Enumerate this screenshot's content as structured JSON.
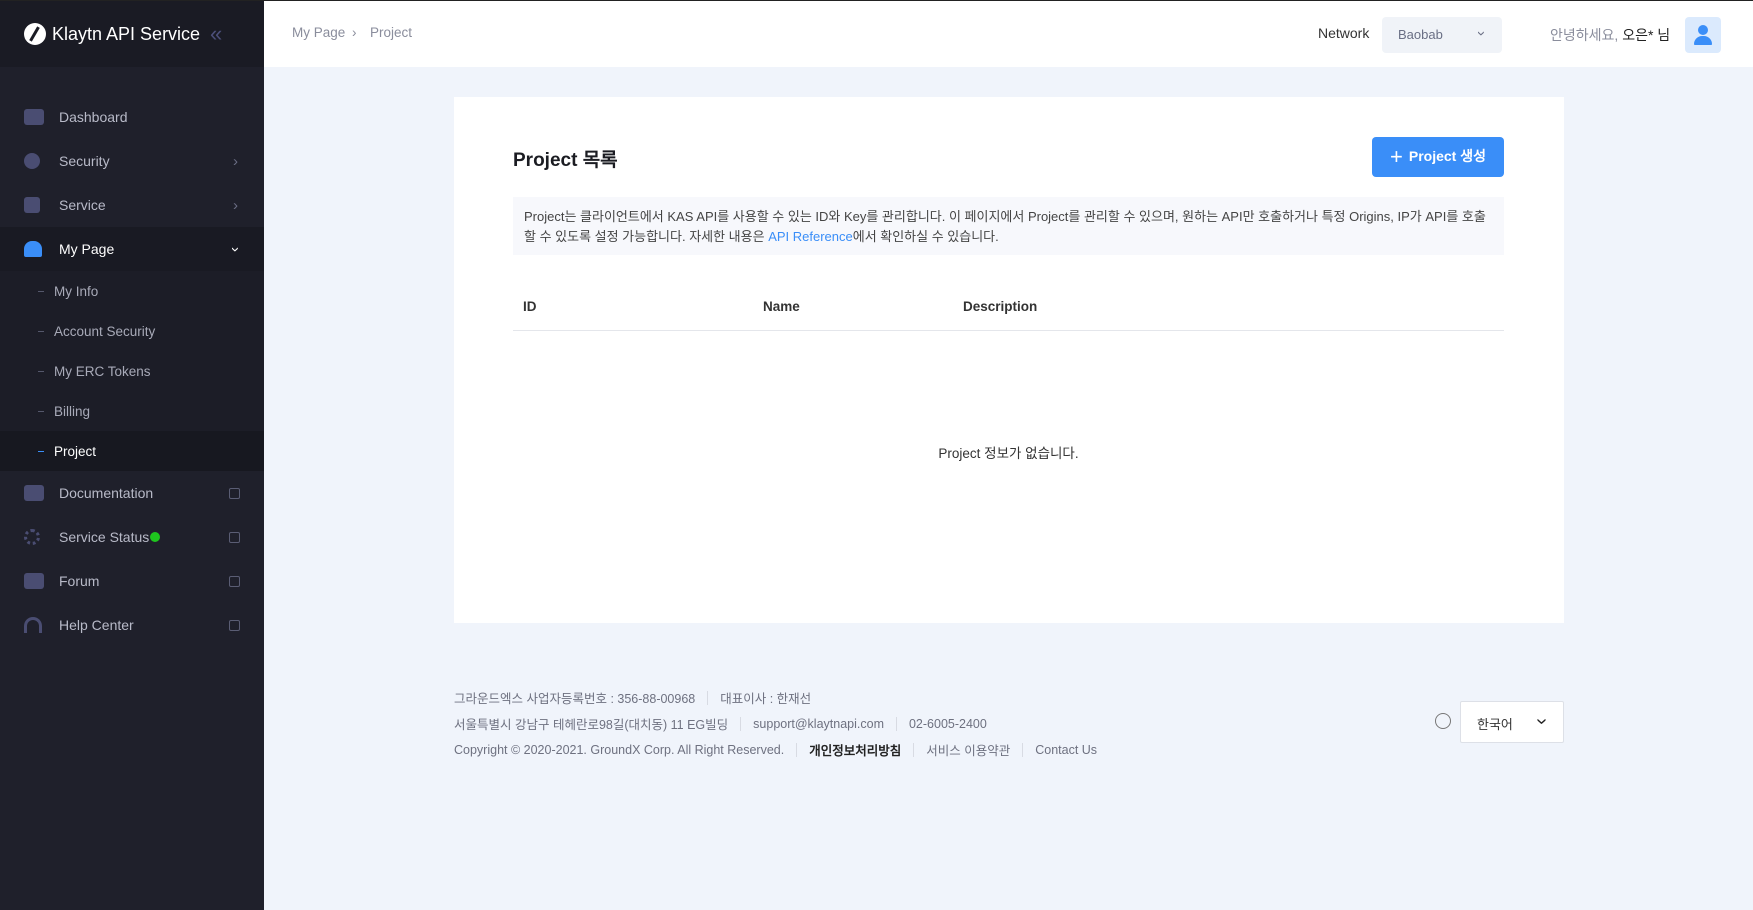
{
  "app": {
    "title": "Klaytn API Service"
  },
  "sidebar": {
    "items": [
      {
        "label": "Dashboard"
      },
      {
        "label": "Security"
      },
      {
        "label": "Service"
      },
      {
        "label": "My Page"
      },
      {
        "label": "Documentation"
      },
      {
        "label": "Service Status"
      },
      {
        "label": "Forum"
      },
      {
        "label": "Help Center"
      }
    ],
    "sub_items": [
      {
        "label": "My Info"
      },
      {
        "label": "Account Security"
      },
      {
        "label": "My ERC Tokens"
      },
      {
        "label": "Billing"
      },
      {
        "label": "Project"
      }
    ],
    "status_color": "#1ec51e"
  },
  "header": {
    "breadcrumb": [
      "My Page",
      "Project"
    ],
    "network_label": "Network",
    "network_value": "Baobab",
    "greeting": "안녕하세요,",
    "user": "오은* 님"
  },
  "main": {
    "title": "Project 목록",
    "create_button": "Project 생성",
    "info_pre": "Project는 클라이언트에서 KAS API를 사용할 수 있는 ID와 Key를 관리합니다. 이 페이지에서 Project를 관리할 수 있으며, 원하는 API만 호출하거나 특정 Origins, IP가 API를 호출할 수 있도록 설정 가능합니다. 자세한 내용은 ",
    "info_link": "API Reference",
    "info_post": "에서 확인하실 수 있습니다.",
    "columns": [
      "ID",
      "Name",
      "Description"
    ],
    "empty": "Project 정보가 없습니다."
  },
  "footer": {
    "company": "그라운드엑스 사업자등록번호 : 356-88-00968",
    "ceo": "대표이사 : 한재선",
    "address": "서울특별시 강남구 테헤란로98길(대치동) 11 EG빌딩",
    "email": "support@klaytnapi.com",
    "phone": "02-6005-2400",
    "copyright": "Copyright © 2020-2021. GroundX Corp. All Right Reserved.",
    "privacy": "개인정보처리방침",
    "terms": "서비스 이용약관",
    "contact": "Contact Us",
    "language": "한국어"
  },
  "colors": {
    "accent": "#3a8ef8"
  }
}
